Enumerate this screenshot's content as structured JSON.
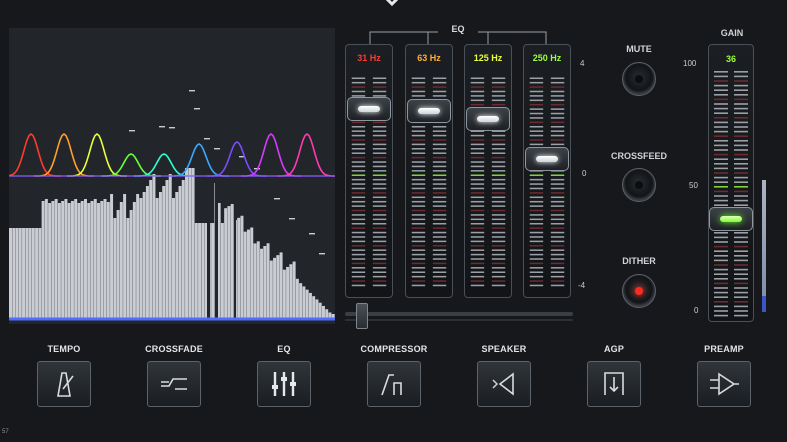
{
  "eq": {
    "title": "EQ",
    "bands": [
      {
        "label": "31 Hz",
        "color": "#ff3b2e",
        "level": 0.78
      },
      {
        "label": "63 Hz",
        "color": "#ffae3a",
        "level": 0.74
      },
      {
        "label": "125 Hz",
        "color": "#e9ff3a",
        "level": 0.7
      },
      {
        "label": "250 Hz",
        "color": "#9cff3a",
        "level": 0.55
      }
    ],
    "scale": {
      "top": "4",
      "mid": "0",
      "bottom": "-4"
    }
  },
  "controls": {
    "mute_label": "MUTE",
    "crossfeed_label": "CROSSFEED",
    "dither_label": "DITHER",
    "dither_on": true
  },
  "gain": {
    "label": "GAIN",
    "value": "36",
    "scale": {
      "top": "100",
      "mid": "50",
      "bottom": "0"
    }
  },
  "effects": [
    {
      "label": "TEMPO",
      "icon": "metronome-icon"
    },
    {
      "label": "CROSSFADE",
      "icon": "crossfade-icon"
    },
    {
      "label": "EQ",
      "icon": "equalizer-icon"
    },
    {
      "label": "COMPRESSOR",
      "icon": "compressor-icon"
    },
    {
      "label": "SPEAKER",
      "icon": "speaker-icon"
    },
    {
      "label": "AGP",
      "icon": "agp-icon"
    },
    {
      "label": "PREAMP",
      "icon": "preamp-icon"
    }
  ],
  "corner_text": "57",
  "colors": {
    "curve_colors": [
      "#ff3b2e",
      "#ff9f2e",
      "#e9ff3a",
      "#6bff3a",
      "#2effd0",
      "#3aa8ff",
      "#7a4cff",
      "#d93aff",
      "#ff3ab0"
    ],
    "baseline": "#4f6cff"
  }
}
